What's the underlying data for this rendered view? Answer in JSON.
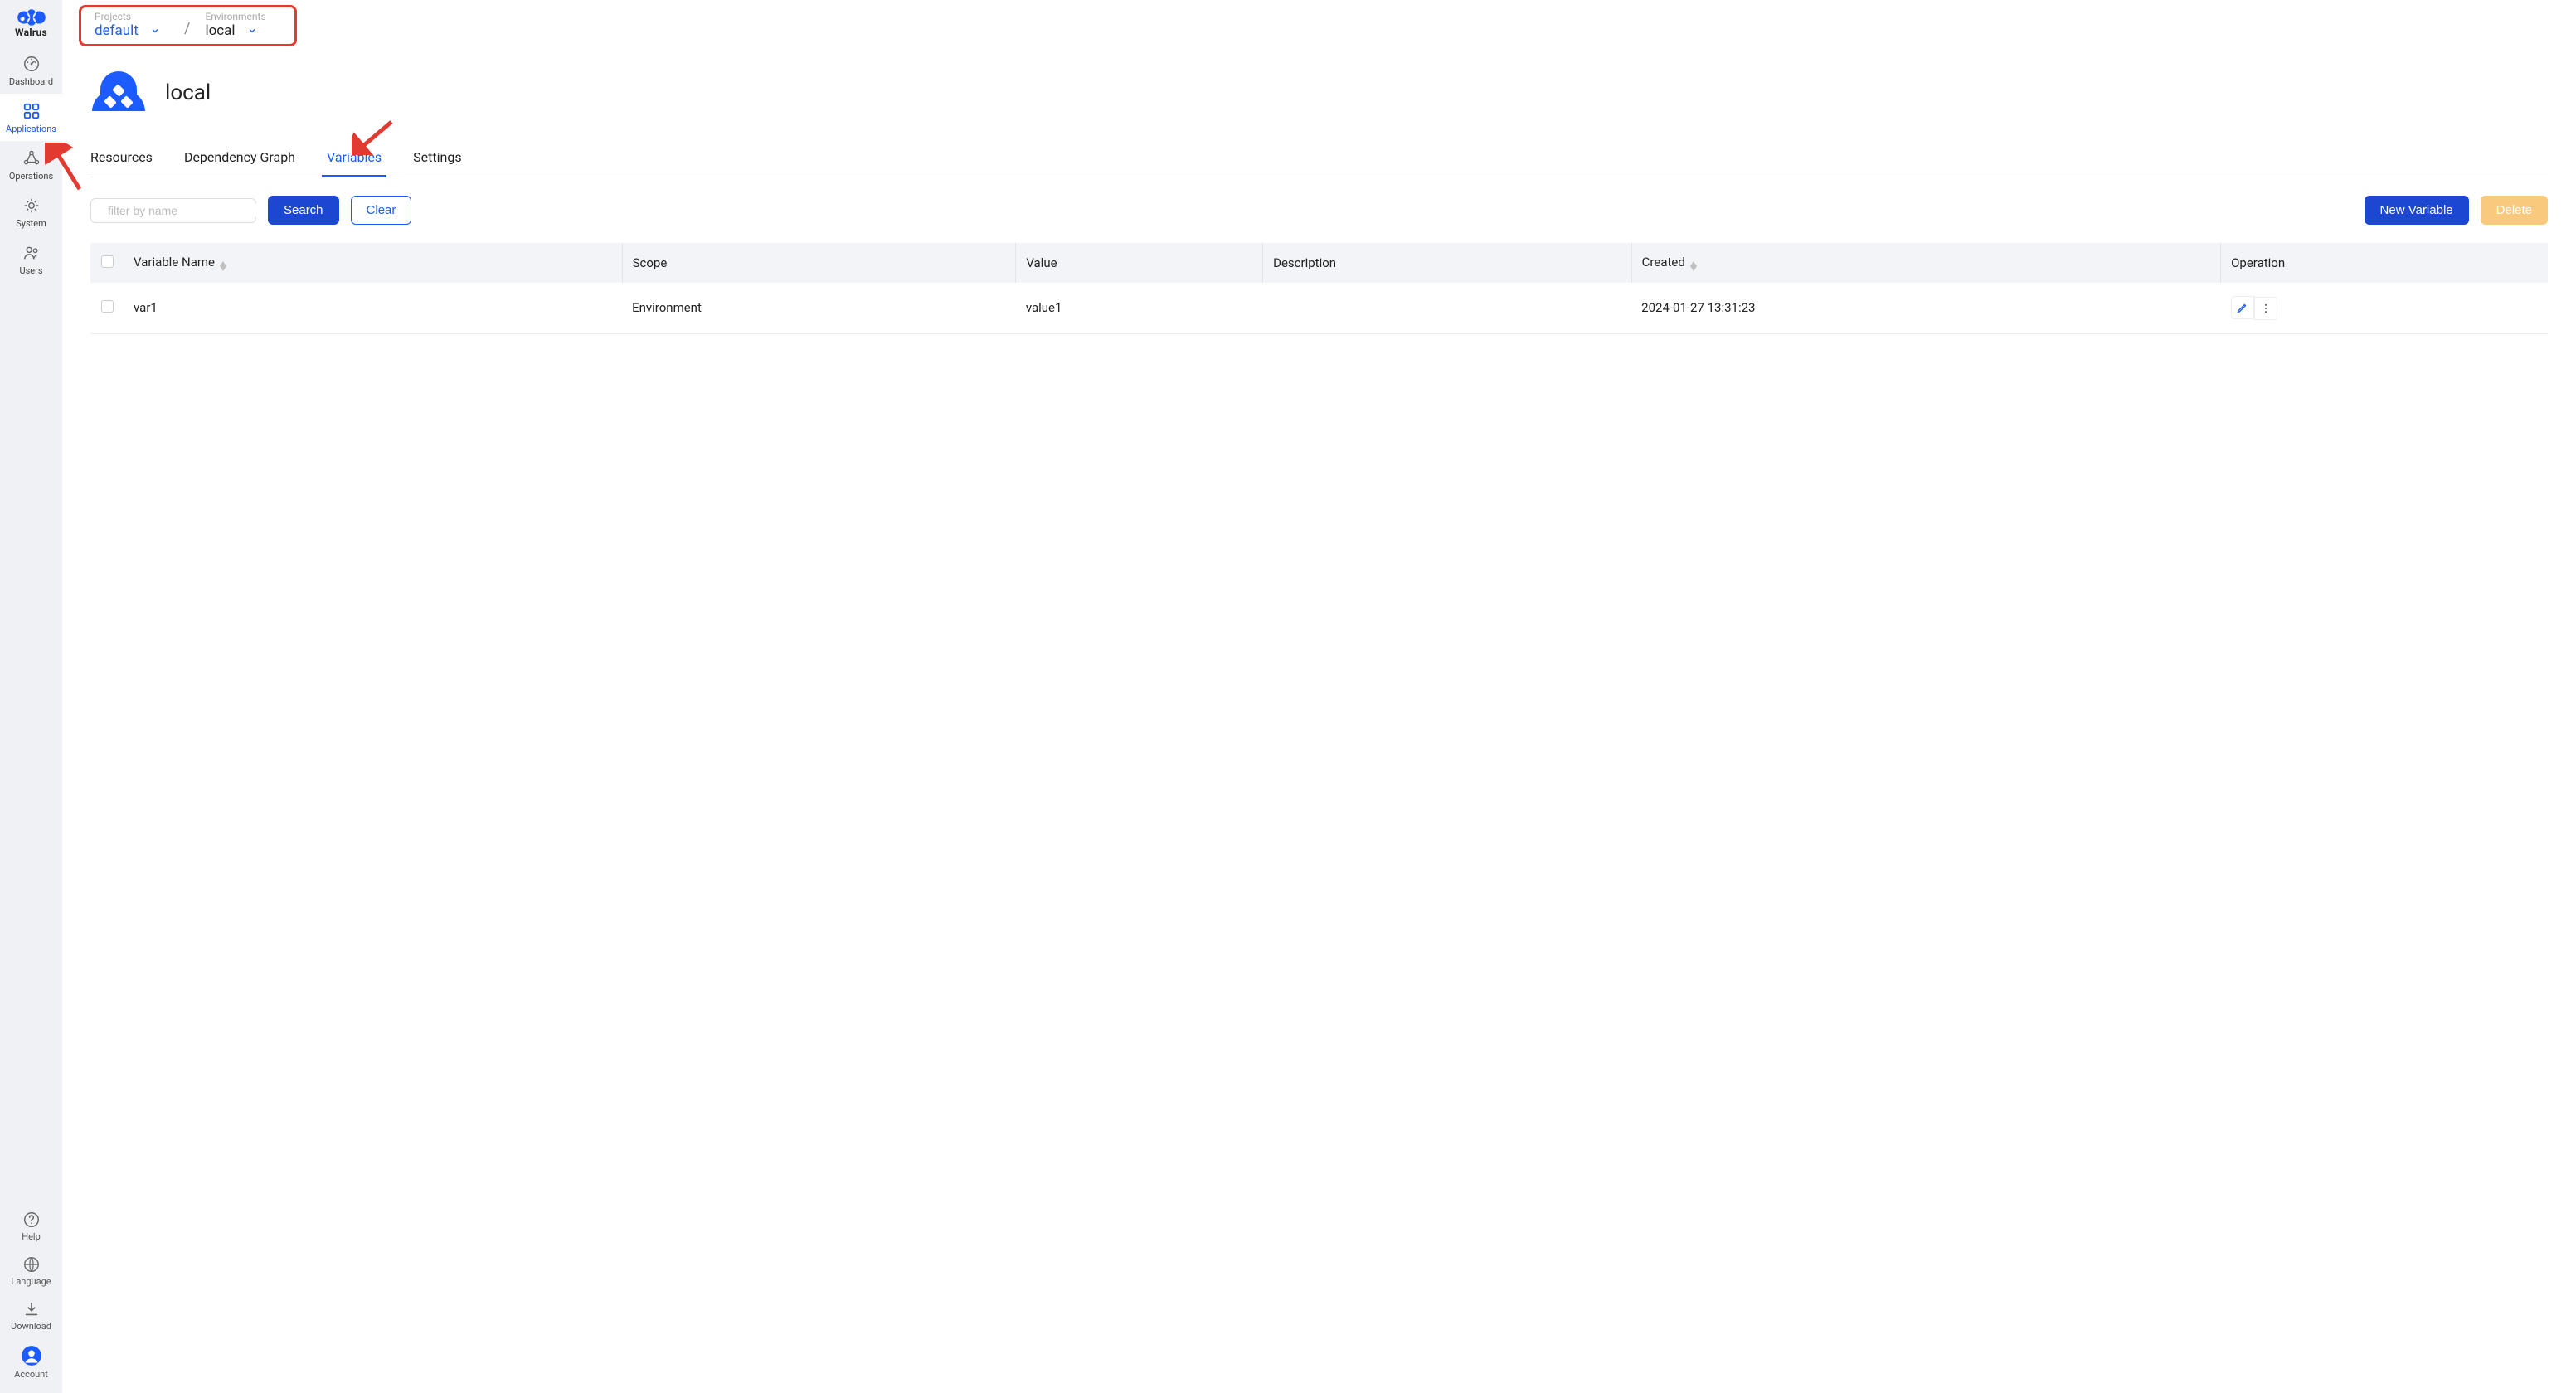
{
  "brand": {
    "name": "Walrus"
  },
  "sidebar": {
    "items": [
      {
        "label": "Dashboard"
      },
      {
        "label": "Applications"
      },
      {
        "label": "Operations"
      },
      {
        "label": "System"
      },
      {
        "label": "Users"
      }
    ],
    "footer": [
      {
        "label": "Help"
      },
      {
        "label": "Language"
      },
      {
        "label": "Download"
      },
      {
        "label": "Account"
      }
    ]
  },
  "breadcrumb": {
    "project_label": "Projects",
    "project_value": "default",
    "env_label": "Environments",
    "env_value": "local"
  },
  "page": {
    "title": "local"
  },
  "tabs": [
    {
      "label": "Resources"
    },
    {
      "label": "Dependency Graph"
    },
    {
      "label": "Variables"
    },
    {
      "label": "Settings"
    }
  ],
  "toolbar": {
    "filter_placeholder": "filter by name",
    "search": "Search",
    "clear": "Clear",
    "new": "New Variable",
    "delete": "Delete"
  },
  "table": {
    "headers": {
      "name": "Variable Name",
      "scope": "Scope",
      "value": "Value",
      "description": "Description",
      "created": "Created",
      "operation": "Operation"
    },
    "rows": [
      {
        "name": "var1",
        "scope": "Environment",
        "value": "value1",
        "description": "",
        "created": "2024-01-27 13:31:23"
      }
    ]
  }
}
